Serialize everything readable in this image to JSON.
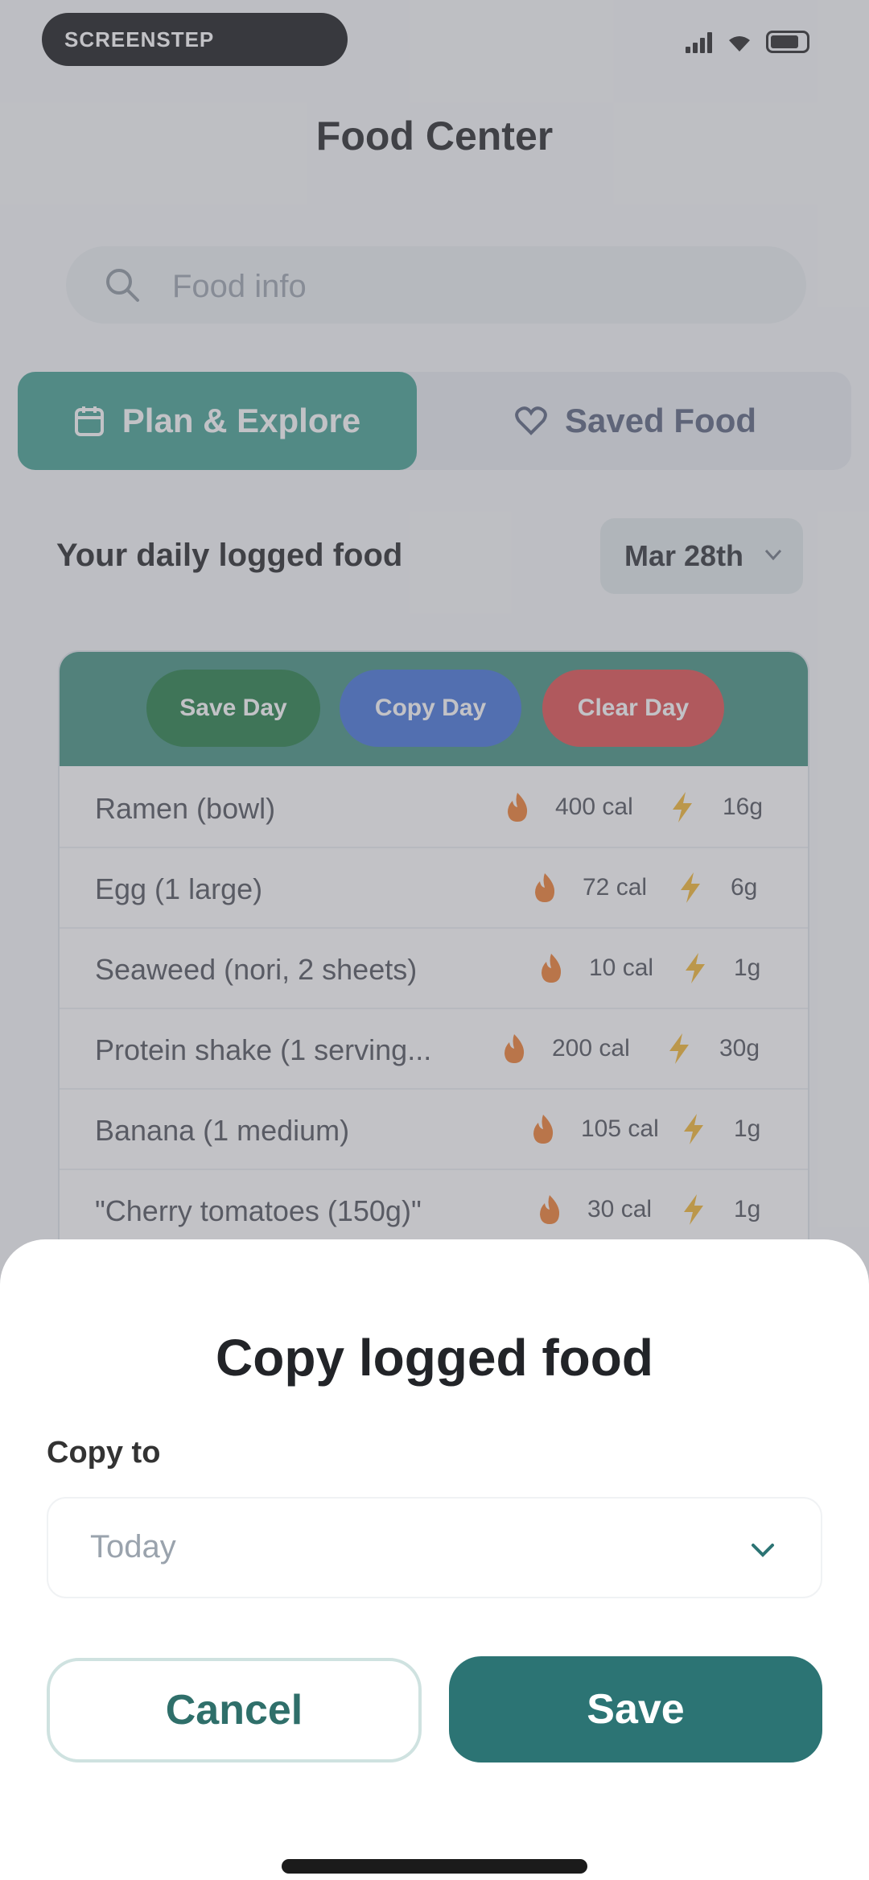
{
  "status_bar": {
    "brand": "SCREENSTEP",
    "icons": [
      "signal-icon",
      "wifi-icon",
      "battery-icon"
    ]
  },
  "header": {
    "title": "Food Center"
  },
  "search": {
    "placeholder": "Food info"
  },
  "tabs": [
    {
      "label": "Plan & Explore",
      "active": true,
      "icon": "calendar-icon"
    },
    {
      "label": "Saved Food",
      "active": false,
      "icon": "heart-icon"
    }
  ],
  "daily": {
    "label": "Your daily logged food",
    "date": "Mar 28th"
  },
  "actions": [
    {
      "label": "Save Day",
      "color": "#1e7a42"
    },
    {
      "label": "Copy Day",
      "color": "#3f70d9"
    },
    {
      "label": "Clear Day",
      "color": "#e04a4a"
    }
  ],
  "food_items": [
    {
      "name": "Ramen (bowl)",
      "calories": "400 cal",
      "protein": "16g"
    },
    {
      "name": "Egg (1 large)",
      "calories": "72 cal",
      "protein": "6g"
    },
    {
      "name": "Seaweed (nori, 2 sheets)",
      "calories": "10 cal",
      "protein": "1g"
    },
    {
      "name": "Protein shake (1 serving...",
      "calories": "200 cal",
      "protein": "30g"
    },
    {
      "name": "Banana (1 medium)",
      "calories": "105 cal",
      "protein": "1g"
    },
    {
      "name": "\"Cherry tomatoes (150g)\"",
      "calories": "30 cal",
      "protein": "1g"
    }
  ],
  "dialog": {
    "title": "Copy logged food",
    "copy_to_label": "Copy to",
    "selected": "Today",
    "cancel": "Cancel",
    "save": "Save"
  },
  "colors": {
    "accent": "#3f9f8f",
    "header": "#3f907f",
    "save_button": "#2c7474"
  }
}
